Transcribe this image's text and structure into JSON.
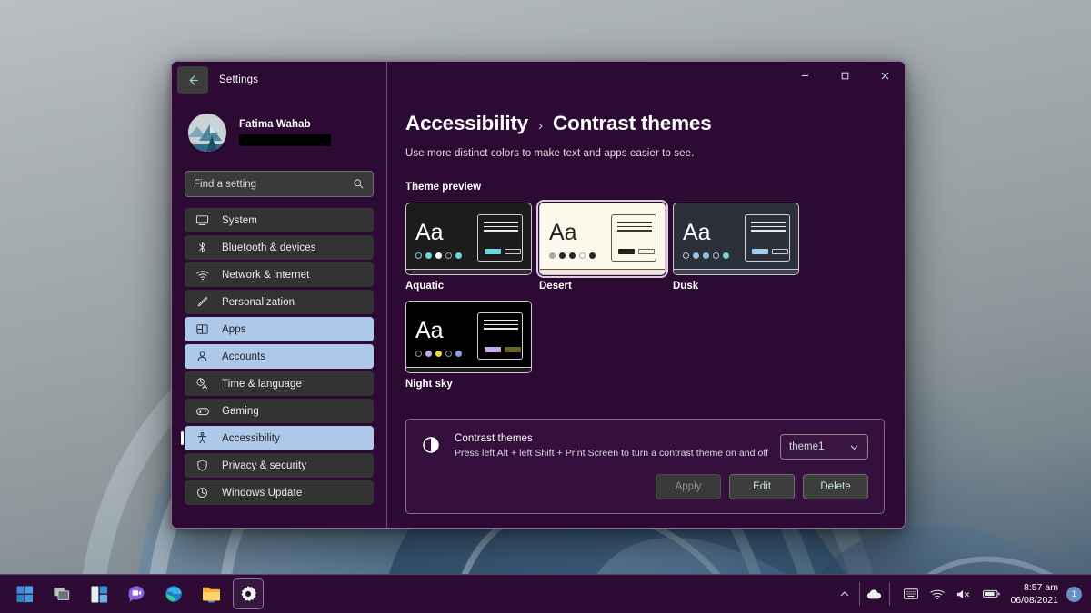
{
  "window": {
    "app_title": "Settings",
    "back_icon": "back-arrow-icon",
    "controls": {
      "minimize": "minimize-icon",
      "maximize": "maximize-icon",
      "close": "close-icon"
    }
  },
  "sidebar": {
    "user": {
      "name": "Fatima Wahab",
      "email_redacted": ""
    },
    "search": {
      "placeholder": "Find a setting",
      "value": "",
      "icon": "search-icon"
    },
    "items": [
      {
        "label": "System",
        "icon": "monitor-icon",
        "state": "normal"
      },
      {
        "label": "Bluetooth & devices",
        "icon": "bluetooth-icon",
        "state": "normal"
      },
      {
        "label": "Network & internet",
        "icon": "wifi-icon",
        "state": "normal"
      },
      {
        "label": "Personalization",
        "icon": "brush-icon",
        "state": "normal"
      },
      {
        "label": "Apps",
        "icon": "apps-grid-icon",
        "state": "highlight"
      },
      {
        "label": "Accounts",
        "icon": "person-icon",
        "state": "highlight"
      },
      {
        "label": "Time & language",
        "icon": "language-icon",
        "state": "normal"
      },
      {
        "label": "Gaming",
        "icon": "gamepad-icon",
        "state": "normal"
      },
      {
        "label": "Accessibility",
        "icon": "accessibility-icon",
        "state": "selected"
      },
      {
        "label": "Privacy & security",
        "icon": "shield-icon",
        "state": "normal"
      },
      {
        "label": "Windows Update",
        "icon": "update-icon",
        "state": "normal"
      }
    ]
  },
  "main": {
    "breadcrumb": {
      "parent": "Accessibility",
      "separator": "›",
      "current": "Contrast themes"
    },
    "subtitle": "Use more distinct colors to make text and apps easier to see.",
    "theme_preview_label": "Theme preview",
    "themes": [
      {
        "name": "Aquatic",
        "focused": false,
        "bg": "#1c1c1c",
        "text_color": "#ffffff",
        "aa": "Aa",
        "border": "#cfc6d2",
        "dots": [
          "outline:#7ad4e0",
          "#69d3e0",
          "#ffffff",
          "outline:#a99fb0",
          "#69d3e0"
        ],
        "window_bg": "#1c1c1c",
        "window_border": "#d3cbd6",
        "line_color": "#e8e8e8",
        "btn_primary": "#6fd4e2",
        "btn_secondary": "outline:#cfc6d2",
        "taskbar_bg": "#2a2a2a",
        "taskbar_border": "#cfc6d2"
      },
      {
        "name": "Desert",
        "focused": true,
        "bg": "#fdf8ec",
        "text_color": "#26211a",
        "aa": "Aa",
        "border": "#cfc6d2",
        "dots": [
          "#b0a89c",
          "#2b2620",
          "#2b2620",
          "outline:#b0a89c",
          "#2b2620"
        ],
        "window_bg": "#fdf8ec",
        "window_border": "#5f584a",
        "line_color": "#3a342a",
        "btn_primary": "#221d16",
        "btn_secondary": "outline:#6b6354",
        "taskbar_bg": "#ece5d4",
        "taskbar_border": "#5f584a"
      },
      {
        "name": "Dusk",
        "focused": false,
        "bg": "#2b303a",
        "text_color": "#ffffff",
        "aa": "Aa",
        "border": "#cfc6d2",
        "dots": [
          "outline:#b6c2d6",
          "#9cc0e8",
          "#8fc4df",
          "outline:#b6c2d6",
          "#6fd9c8"
        ],
        "window_bg": "#2b303a",
        "window_border": "#d3cbd6",
        "line_color": "#e8e8e8",
        "btn_primary": "#a8cbf0",
        "btn_secondary": "outline:#cfc6d2",
        "taskbar_bg": "#3a404c",
        "taskbar_border": "#cfc6d2"
      },
      {
        "name": "Night sky",
        "focused": false,
        "bg": "#000000",
        "text_color": "#ffffff",
        "aa": "Aa",
        "border": "#cfc6d2",
        "dots": [
          "outline:#8e8e8e",
          "#c9a6ef",
          "#ebd63f",
          "outline:#8e8e8e",
          "#8f9ced"
        ],
        "window_bg": "#000000",
        "window_border": "#d3cbd6",
        "line_color": "#e8e8e8",
        "btn_primary": "#c9a6ef",
        "btn_secondary": "#6b6325",
        "taskbar_bg": "#1a1a1a",
        "taskbar_border": "#cfc6d2"
      }
    ],
    "contrast_card": {
      "icon": "contrast-half-circle-icon",
      "title": "Contrast themes",
      "description": "Press left Alt + left Shift + Print Screen to turn a contrast theme on and off",
      "select": {
        "value": "theme1",
        "chevron": "chevron-down-icon"
      },
      "buttons": [
        {
          "label": "Apply",
          "disabled": true
        },
        {
          "label": "Edit",
          "disabled": false
        },
        {
          "label": "Delete",
          "disabled": false
        }
      ]
    }
  },
  "taskbar": {
    "items": [
      {
        "icon": "start-windows-icon",
        "active": false
      },
      {
        "icon": "task-view-icon",
        "active": false
      },
      {
        "icon": "widgets-icon",
        "active": false
      },
      {
        "icon": "chat-teams-icon",
        "active": false
      },
      {
        "icon": "edge-browser-icon",
        "active": false
      },
      {
        "icon": "file-explorer-icon",
        "active": false
      },
      {
        "icon": "settings-gear-icon",
        "active": true
      }
    ],
    "tray": {
      "chevron": "chevron-up-icon",
      "cloud": "onedrive-cloud-icon",
      "keyboard": "keyboard-ime-icon",
      "wifi": "wifi-icon",
      "volume": "volume-muted-icon",
      "battery": "battery-icon",
      "time": "8:57 am",
      "date": "06/08/2021",
      "notification_count": "1"
    }
  },
  "colors": {
    "window_bg": "#2d0a33",
    "accent_highlight": "#aec8ea",
    "nav_item_bg": "#333333",
    "taskbar_bg": "#2e0b34"
  }
}
